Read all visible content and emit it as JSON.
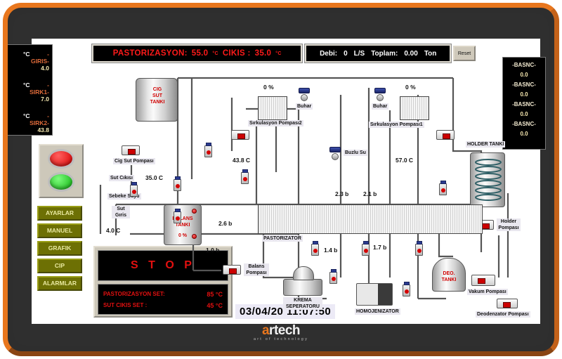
{
  "brand": {
    "name": "artech",
    "tagline": "art of technology"
  },
  "topbar": {
    "pastorizasyon_label": "PASTORIZASYON:",
    "pastorizasyon_value": "55.0",
    "pastorizasyon_unit": "°C",
    "cikis_label": "CIKIS :",
    "cikis_value": "35.0",
    "cikis_unit": "°C",
    "debi_label": "Debi:",
    "debi_value": "0",
    "debi_unit": "L/S",
    "toplam_label": "Toplam:",
    "toplam_value": "0.00",
    "toplam_unit": "Ton",
    "reset_label": "Reset"
  },
  "left_readout": {
    "items": [
      {
        "label": "-GIRIS-",
        "value": "4.0",
        "unit": "°C"
      },
      {
        "label": "-SIRK1-",
        "value": "7.0",
        "unit": "°C"
      },
      {
        "label": "-SIRK2-",
        "value": "43.8",
        "unit": "°C"
      }
    ]
  },
  "right_readout": {
    "items": [
      {
        "label": "-BASNC-",
        "value": "0.0"
      },
      {
        "label": "-BASNC-",
        "value": "0.0"
      },
      {
        "label": "-BASNC-",
        "value": "0.0"
      },
      {
        "label": "-BASNC-",
        "value": "0.0"
      }
    ]
  },
  "lamps": [
    {
      "name": "red-indicator-lamp",
      "color": "#d90000"
    },
    {
      "name": "green-indicator-lamp",
      "color": "#0fb50f"
    }
  ],
  "nav_buttons": [
    {
      "label": "AYARLAR"
    },
    {
      "label": "MANUEL"
    },
    {
      "label": "GRAFIK"
    },
    {
      "label": "CIP"
    },
    {
      "label": "ALARMLAR"
    }
  ],
  "status_panel": {
    "state": "S T O P",
    "setpoints": [
      {
        "label": "PASTORIZASYON SET:",
        "value": "85 °C"
      },
      {
        "label": "SUT CIKIS SET       :",
        "value": "45 °C"
      }
    ]
  },
  "clock": "03/04/20 11:07:50",
  "diagram": {
    "equipment": [
      {
        "name": "cig-sut-tanki",
        "label": "CIG\nSUT\nTANKI"
      },
      {
        "name": "cig-sut-pompasi",
        "label": "Cig Sut Pompası"
      },
      {
        "name": "balans-tanki",
        "label": "BALANS\nTANKI"
      },
      {
        "name": "balans-pompasi",
        "label": "Balans\nPompası"
      },
      {
        "name": "pastorizator",
        "label": "PASTORIZATOR"
      },
      {
        "name": "sirkulasyon-pompasi-2",
        "label": "Sırkulasyon Pompası2"
      },
      {
        "name": "sirkulasyon-pompasi-1",
        "label": "Sırkulasyon Pompası1"
      },
      {
        "name": "holder-tanki",
        "label": "HOLDER TANKI"
      },
      {
        "name": "holder-pompasi",
        "label": "Holder\nPompası"
      },
      {
        "name": "krema-seperatoru",
        "label": "KREMA\nSEPERATORU"
      },
      {
        "name": "homojenizator",
        "label": "HOMOJENIZATOR"
      },
      {
        "name": "deo-tanki",
        "label": "DEO.\nTANKI"
      },
      {
        "name": "vakum-pompasi",
        "label": "Vakum Pompası"
      },
      {
        "name": "deodenzator-pompasi",
        "label": "Deodenzator Pompası"
      },
      {
        "name": "buhar-valve-left",
        "label": "Buhar"
      },
      {
        "name": "buhar-valve-right",
        "label": "Buhar"
      },
      {
        "name": "buzlu-su-valve",
        "label": "Buzlu Su"
      },
      {
        "name": "sebeke-suyu",
        "label": "Sebeke  Suyu"
      },
      {
        "name": "sut-giris",
        "label": "Sut\nGıris"
      },
      {
        "name": "sut-cikisi",
        "label": "Sut Cıkısı"
      }
    ],
    "readings": [
      {
        "name": "valve-open-pct-left",
        "value": "0 %"
      },
      {
        "name": "valve-open-pct-right",
        "value": "0 %"
      },
      {
        "name": "balans-tanki-level",
        "value": "0 %"
      },
      {
        "name": "sut-cikisi-temp",
        "value": "35.0 C"
      },
      {
        "name": "sut-giris-temp",
        "value": "4.0 C"
      },
      {
        "name": "sirkulasyon-2-temp",
        "value": "43.8 C"
      },
      {
        "name": "sirkulasyon-1-temp",
        "value": "57.0 C"
      },
      {
        "name": "pressure-balans",
        "value": "1.0 b"
      },
      {
        "name": "pressure-regen-in",
        "value": "2.6 b"
      },
      {
        "name": "pressure-regen-top-1",
        "value": "2.3 b"
      },
      {
        "name": "pressure-regen-top-2",
        "value": "2.1 b"
      },
      {
        "name": "pressure-seperator",
        "value": "1.4 b"
      },
      {
        "name": "pressure-homojenizator",
        "value": "1.7 b"
      }
    ]
  }
}
